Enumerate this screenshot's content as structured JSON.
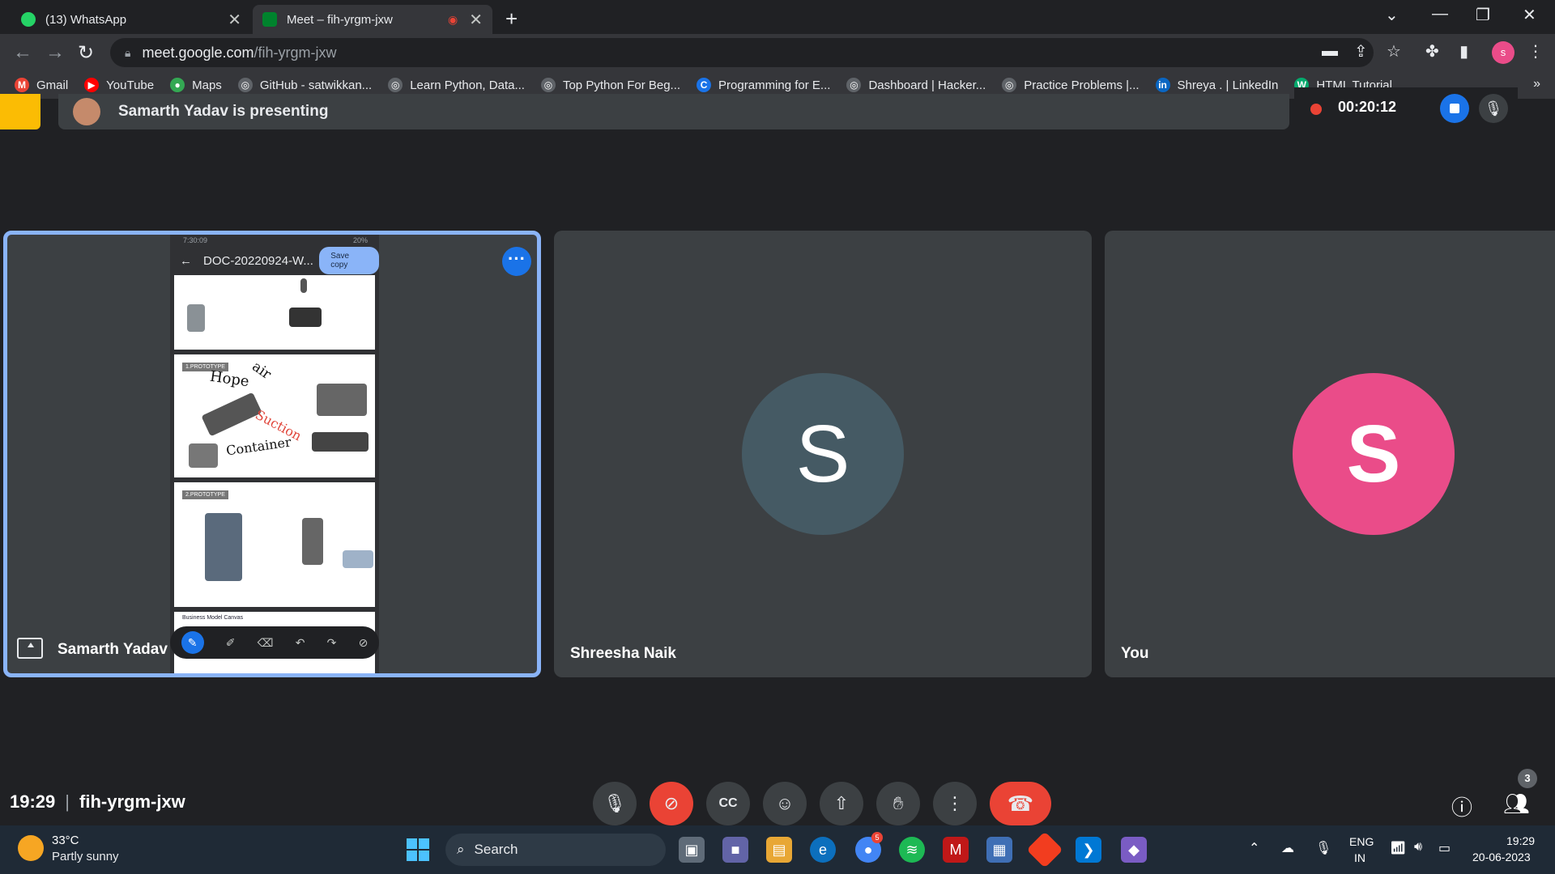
{
  "browser": {
    "tabs": [
      {
        "title": "(13) WhatsApp",
        "badge": "13",
        "favicon_color": "#25d366"
      },
      {
        "title": "Meet – fih-yrgm-jxw",
        "favicon_color": "#00832d"
      }
    ],
    "url_host": "meet.google.com",
    "url_path": "/fih-yrgm-jxw",
    "profile_initial": "s",
    "bookmarks": [
      {
        "label": "Gmail",
        "icon": "M",
        "color": "#ea4335"
      },
      {
        "label": "YouTube",
        "icon": "▶",
        "color": "#ff0000"
      },
      {
        "label": "Maps",
        "icon": "●",
        "color": "#34a853"
      },
      {
        "label": "GitHub - satwikkan...",
        "icon": "◎",
        "color": "#5f6368"
      },
      {
        "label": "Learn Python, Data...",
        "icon": "◎",
        "color": "#5f6368"
      },
      {
        "label": "Top Python For Beg...",
        "icon": "◎",
        "color": "#5f6368"
      },
      {
        "label": "Programming for E...",
        "icon": "C",
        "color": "#1a73e8"
      },
      {
        "label": "Dashboard | Hacker...",
        "icon": "◎",
        "color": "#5f6368"
      },
      {
        "label": "Practice Problems |...",
        "icon": "◎",
        "color": "#5f6368"
      },
      {
        "label": "Shreya . | LinkedIn",
        "icon": "in",
        "color": "#0a66c2"
      },
      {
        "label": "HTML Tutorial",
        "icon": "W",
        "color": "#04aa6d"
      }
    ]
  },
  "meet": {
    "presenting_text": "Samarth Yadav is presenting",
    "recording_time": "00:20:12",
    "participants": [
      {
        "name": "Samarth Yadav",
        "presenting": true
      },
      {
        "name": "Shreesha Naik",
        "initial": "S",
        "avatar_color": "#455a64"
      },
      {
        "name": "You",
        "initial": "S",
        "avatar_color": "#ea4c89"
      }
    ],
    "shared_screen": {
      "status": "7:30:09",
      "battery": "20%",
      "doc_title": "DOC-20220924-W...",
      "save_copy": "Save copy",
      "ink_words": [
        "Hope",
        "air",
        "Suction",
        "Container"
      ],
      "prototype_labels": [
        "1.PROTOTYPE",
        "2.PROTOTYPE"
      ],
      "section_footer": "Business Model Canvas"
    },
    "clock": "19:29",
    "meeting_code": "fih-yrgm-jxw",
    "people_count": "3"
  },
  "taskbar": {
    "temperature": "33°C",
    "weather": "Partly sunny",
    "search_placeholder": "Search",
    "notification_count": "5",
    "lang1": "ENG",
    "lang2": "IN",
    "time": "19:29",
    "date": "20-06-2023"
  }
}
